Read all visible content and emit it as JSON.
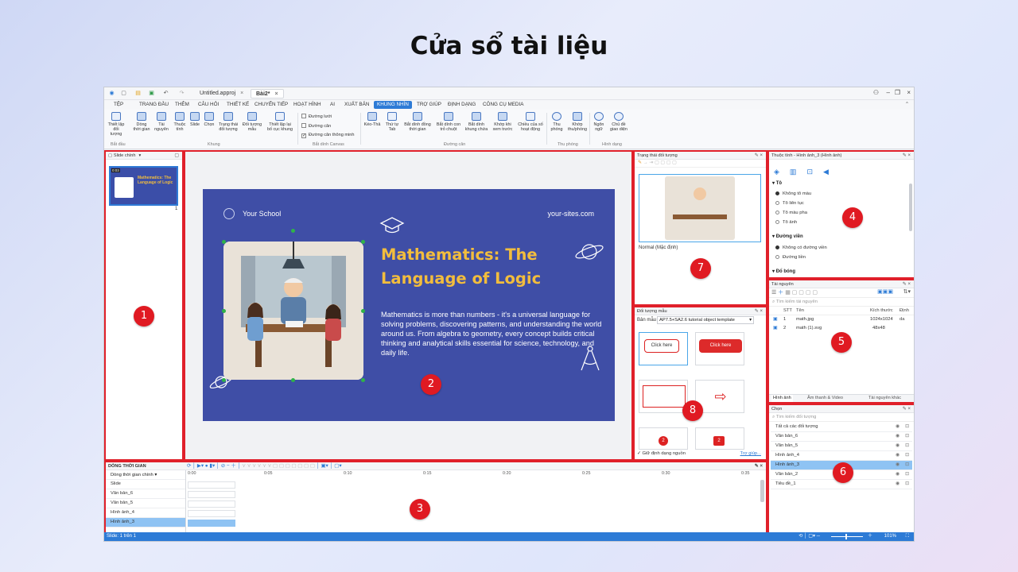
{
  "heading": "Cửa sổ tài liệu",
  "titlebar": {
    "tabs": [
      {
        "label": "Untitled.approj",
        "close": "×"
      },
      {
        "label": "Bài2*",
        "close": "×"
      }
    ],
    "window_controls": [
      "‒",
      "❐",
      "×"
    ]
  },
  "menu": [
    "TỆP",
    "TRANG ĐẦU",
    "THÊM",
    "CÂU HỎI",
    "THIẾT KẾ",
    "CHUYỂN TIẾP",
    "HOẠT HÌNH",
    "AI",
    "XUẤT BẢN",
    "KHUNG NHÌN",
    "TRỢ GIÚP",
    "ĐỊNH DẠNG",
    "CÔNG CỤ MEDIA"
  ],
  "ribbon": {
    "buttons": [
      "Thiết lập\nđối tượng",
      "Dòng\nthời gian",
      "Tài\nnguyên",
      "Thuộc\ntính",
      "Slide",
      "Chọn",
      "Trạng thái\nđối tượng",
      "Đối tượng\nmẫu",
      "Thiết lập lại\nbố cục khung",
      "Kéo-Thả",
      "Thứ tự\nTab",
      "Bắt dính đồng\nthời gian",
      "Bắt dính con\ntrỏ chuột",
      "Bắt dính\nkhung chứa",
      "Khớp khi\nxem trước",
      "Chiều của số\nhoạt động",
      "Thu\nphóng",
      "Khớp\nthu/phóng",
      "Ngôn\nngữ",
      "Chủ đề\ngiao diện"
    ],
    "checks": [
      {
        "label": "Đường lưới",
        "checked": false
      },
      {
        "label": "Đường căn",
        "checked": false
      },
      {
        "label": "Đường căn thông minh",
        "checked": true
      }
    ],
    "groups": [
      "Bắt đầu",
      "Khung",
      "Bắt dính Canvas",
      "Đường căn",
      "Thu phóng",
      "Hình dạng"
    ]
  },
  "slides_panel": {
    "dropdown": "Slide chính",
    "thumb_number": "1",
    "thumb_time": "0:03"
  },
  "slide": {
    "school": "Your School",
    "site": "your-sites.com",
    "title": "Mathematics: The Language of Logic",
    "body": "Mathematics is more than numbers - it's a universal language for solving problems, discovering patterns, and understanding the world around us. From algebra to geometry, every concept builds critical thinking and analytical skills essential for science, technology, and daily life."
  },
  "object_state": {
    "title": "Trạng thái đối tượng",
    "state_label": "Normal (Mặc định)"
  },
  "properties": {
    "title": "Thuộc tính - Hình ảnh_3 (Hình ảnh)",
    "sections": [
      {
        "name": "Tô",
        "options": [
          "Không tô màu",
          "Tô liên tục",
          "Tô màu pha",
          "Tô ảnh"
        ],
        "selected": 0
      },
      {
        "name": "Đường viền",
        "options": [
          "Không có đường viền",
          "Đường liền"
        ],
        "selected": 0
      },
      {
        "name": "Đổ bóng",
        "options": [],
        "selected": -1
      }
    ]
  },
  "resources": {
    "title": "Tài nguyên",
    "search_placeholder": "Tìm kiếm tài nguyên",
    "columns": [
      "STT",
      "Tên",
      "Kích thước",
      "Định da"
    ],
    "rows": [
      {
        "no": "1",
        "name": "math.jpg",
        "size": "1024x1024"
      },
      {
        "no": "2",
        "name": "math (1).svg",
        "size": "48x48"
      }
    ],
    "tabs": [
      "Hình ảnh",
      "Âm thanh & Video",
      "Tài nguyên khác"
    ]
  },
  "templates": {
    "title": "Đối tượng mẫu",
    "label": "Bản mẫu",
    "select": "AP7.5+SA2.6 tutorial object template",
    "items": [
      "Click here",
      "Click here",
      "",
      "⇨",
      "2",
      "2"
    ],
    "footer_check": "Giữ định dạng nguồn",
    "help_link": "Trợ giúp..."
  },
  "selection": {
    "title": "Chọn",
    "search_placeholder": "Tìm kiếm đối tượng",
    "rows": [
      "Tất cả các đối tượng",
      "Văn bản_6",
      "Văn bản_5",
      "Hình ảnh_4",
      "Hình ảnh_3",
      "Văn bản_2",
      "Tiêu đề_1"
    ],
    "selected_index": 4
  },
  "timeline": {
    "title": "DÒNG THỜI GIAN",
    "dropdown": "Dòng thời gian chính",
    "rows": [
      "Slide",
      "Văn bản_6",
      "Văn bản_5",
      "Hình ảnh_4",
      "Hình ảnh_3"
    ],
    "selected_index": 4,
    "ruler": [
      "0:00",
      "0:05",
      "0:10",
      "0:15",
      "0:20",
      "0:25",
      "0:30",
      "0:35"
    ]
  },
  "status": {
    "left": "Slide: 1 trên 1",
    "zoom": "101%"
  },
  "badges": [
    "1",
    "2",
    "3",
    "4",
    "5",
    "6",
    "7",
    "8"
  ]
}
